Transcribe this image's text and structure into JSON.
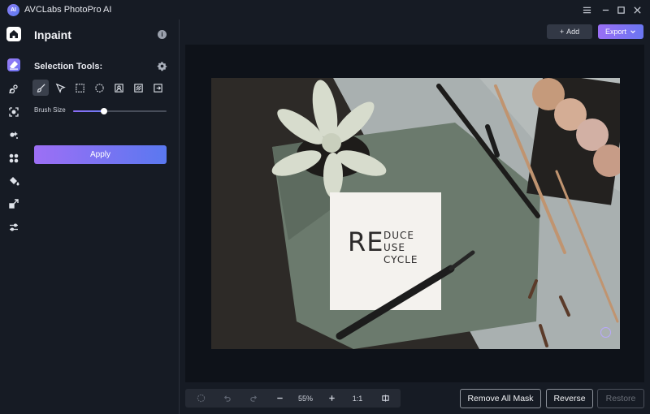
{
  "app": {
    "title": "AVCLabs PhotoPro AI",
    "logo_text": "AI"
  },
  "titlebar_icons": [
    "menu-icon",
    "minimize-icon",
    "maximize-icon",
    "close-icon"
  ],
  "rail": {
    "items": [
      {
        "name": "home-icon"
      },
      {
        "name": "inpaint-eraser-icon",
        "active": true
      },
      {
        "name": "face-retouch-icon"
      },
      {
        "name": "background-remove-icon"
      },
      {
        "name": "ai-replace-icon"
      },
      {
        "name": "enhance-icon"
      },
      {
        "name": "colorize-icon"
      },
      {
        "name": "upscale-icon"
      },
      {
        "name": "adjust-icon"
      }
    ]
  },
  "panel": {
    "title": "Inpaint",
    "selection_title": "Selection Tools:",
    "tools": [
      "brush-tool-icon",
      "polygon-lasso-icon",
      "rectangle-select-icon",
      "ellipse-select-icon",
      "person-select-icon",
      "pattern-select-icon",
      "import-mask-icon"
    ],
    "brush_label": "Brush Size",
    "brush_size_fraction": 0.33,
    "apply_label": "Apply"
  },
  "header": {
    "add_label": "Add",
    "export_label": "Export"
  },
  "photo": {
    "note_big": "RE",
    "note_lines": [
      "DUCE",
      "USE",
      "CYCLE"
    ]
  },
  "zoombar": {
    "zoom": "55%",
    "one_to_one": "1:1"
  },
  "actions": {
    "remove_all_mask": "Remove All Mask",
    "reverse": "Reverse",
    "restore": "Restore"
  },
  "colors": {
    "accent_start": "#9d6ff5",
    "accent_end": "#5a78f0",
    "background": "#161b24",
    "canvas": "#0e1219"
  }
}
